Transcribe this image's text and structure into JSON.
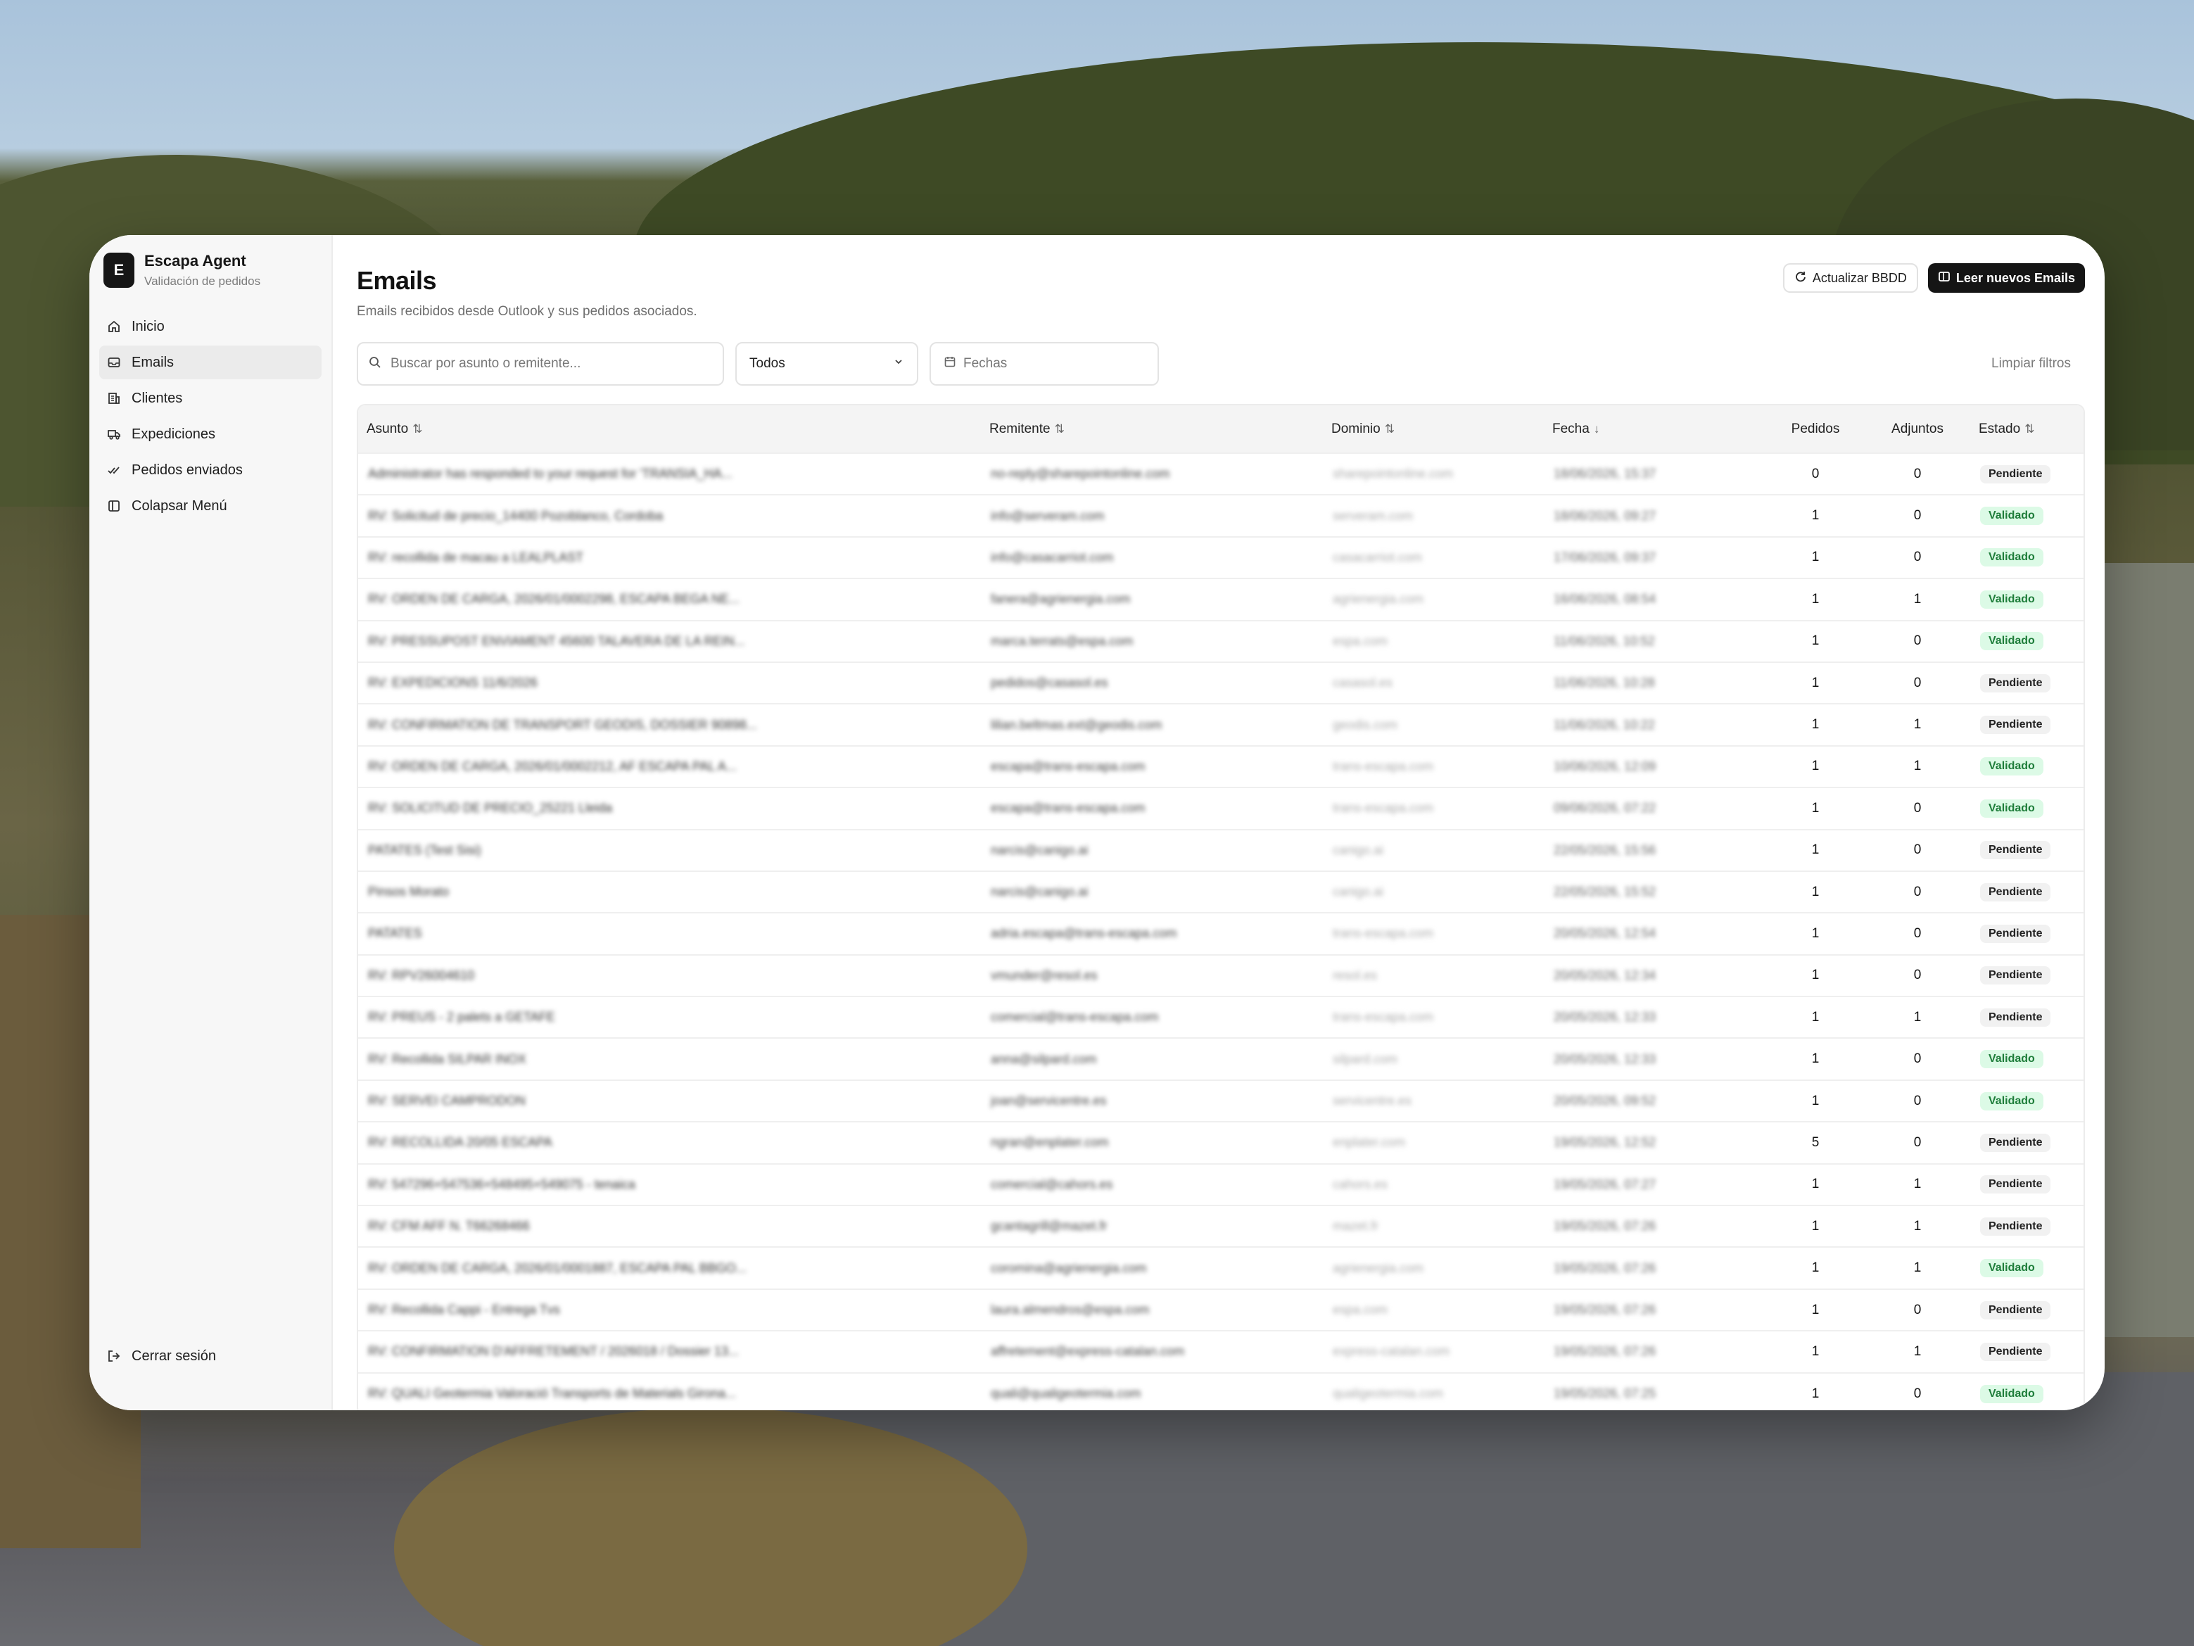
{
  "app": {
    "name": "Escapa Agent",
    "subtitle": "Validación de pedidos",
    "logo_letter": "E"
  },
  "sidebar": {
    "items": [
      {
        "label": "Inicio",
        "icon": "home-icon",
        "active": false
      },
      {
        "label": "Emails",
        "icon": "mail-icon",
        "active": true
      },
      {
        "label": "Clientes",
        "icon": "building-icon",
        "active": false
      },
      {
        "label": "Expediciones",
        "icon": "truck-icon",
        "active": false
      },
      {
        "label": "Pedidos enviados",
        "icon": "check-double-icon",
        "active": false
      },
      {
        "label": "Colapsar Menú",
        "icon": "sidebar-collapse-icon",
        "active": false
      }
    ],
    "logout_label": "Cerrar sesión"
  },
  "header": {
    "title": "Emails",
    "subtitle": "Emails recibidos desde Outlook y sus pedidos asociados.",
    "refresh_label": "Actualizar BBDD",
    "read_label": "Leer nuevos Emails"
  },
  "filters": {
    "search_placeholder": "Buscar por asunto o remitente...",
    "status_selected": "Todos",
    "date_placeholder": "Fechas",
    "clear_label": "Limpiar filtros"
  },
  "table": {
    "columns": {
      "asunto": "Asunto",
      "remitente": "Remitente",
      "dominio": "Dominio",
      "fecha": "Fecha",
      "pedidos": "Pedidos",
      "adjuntos": "Adjuntos",
      "estado": "Estado"
    },
    "rows": [
      {
        "asunto": "Administrator has responded to your request for 'TRANSIA_HA...",
        "remitente": "no-reply@sharepointonline.com",
        "dominio": "sharepointonline.com",
        "fecha": "18/06/2026, 15:37",
        "pedidos": "0",
        "adjuntos": "0",
        "estado": "Pendiente"
      },
      {
        "asunto": "RV: Solicitud de precio_14400 Pozoblanco, Cordoba",
        "remitente": "info@serveram.com",
        "dominio": "serveram.com",
        "fecha": "18/06/2026, 09:27",
        "pedidos": "1",
        "adjuntos": "0",
        "estado": "Validado"
      },
      {
        "asunto": "RV: recollida de macau a LEALPLAST",
        "remitente": "info@casacarriot.com",
        "dominio": "casacarriot.com",
        "fecha": "17/06/2026, 09:37",
        "pedidos": "1",
        "adjuntos": "0",
        "estado": "Validado"
      },
      {
        "asunto": "RV: ORDEN DE CARGA, 2026/01/0002298, ESCAPA BEGA NE...",
        "remitente": "fanera@agrienergia.com",
        "dominio": "agrienergia.com",
        "fecha": "16/06/2026, 08:54",
        "pedidos": "1",
        "adjuntos": "1",
        "estado": "Validado"
      },
      {
        "asunto": "RV: PRESSUPOST ENVIAMENT 45600 TALAVERA DE LA REIN...",
        "remitente": "marca.terrats@espa.com",
        "dominio": "espa.com",
        "fecha": "11/06/2026, 10:52",
        "pedidos": "1",
        "adjuntos": "0",
        "estado": "Validado"
      },
      {
        "asunto": "RV: EXPEDICIONS 11/6/2026",
        "remitente": "pedidos@casasol.es",
        "dominio": "casasol.es",
        "fecha": "11/06/2026, 10:28",
        "pedidos": "1",
        "adjuntos": "0",
        "estado": "Pendiente"
      },
      {
        "asunto": "RV: CONFIRMATION DE TRANSPORT GEODIS, DOSSIER 90898...",
        "remitente": "lilian.beltmas.ext@geodis.com",
        "dominio": "geodis.com",
        "fecha": "11/06/2026, 10:22",
        "pedidos": "1",
        "adjuntos": "1",
        "estado": "Pendiente"
      },
      {
        "asunto": "RV: ORDEN DE CARGA, 2026/01/0002212, AF ESCAPA PAL A...",
        "remitente": "escapa@trans-escapa.com",
        "dominio": "trans-escapa.com",
        "fecha": "10/06/2026, 12:09",
        "pedidos": "1",
        "adjuntos": "1",
        "estado": "Validado"
      },
      {
        "asunto": "RV: SOLICITUD DE PRECIO_25221 Lleida",
        "remitente": "escapa@trans-escapa.com",
        "dominio": "trans-escapa.com",
        "fecha": "09/06/2026, 07:22",
        "pedidos": "1",
        "adjuntos": "0",
        "estado": "Validado"
      },
      {
        "asunto": "PATATES (Test Sisi)",
        "remitente": "narcis@canigo.ai",
        "dominio": "canigo.ai",
        "fecha": "22/05/2026, 15:56",
        "pedidos": "1",
        "adjuntos": "0",
        "estado": "Pendiente"
      },
      {
        "asunto": "Pinsos Morato",
        "remitente": "narcis@canigo.ai",
        "dominio": "canigo.ai",
        "fecha": "22/05/2026, 15:52",
        "pedidos": "1",
        "adjuntos": "0",
        "estado": "Pendiente"
      },
      {
        "asunto": "PATATES",
        "remitente": "adria.escapa@trans-escapa.com",
        "dominio": "trans-escapa.com",
        "fecha": "20/05/2026, 12:54",
        "pedidos": "1",
        "adjuntos": "0",
        "estado": "Pendiente"
      },
      {
        "asunto": "RV: RPV26004610",
        "remitente": "vmunder@resol.es",
        "dominio": "resol.es",
        "fecha": "20/05/2026, 12:34",
        "pedidos": "1",
        "adjuntos": "0",
        "estado": "Pendiente"
      },
      {
        "asunto": "RV: PREUS - 2 palets a GETAFE",
        "remitente": "comercial@trans-escapa.com",
        "dominio": "trans-escapa.com",
        "fecha": "20/05/2026, 12:33",
        "pedidos": "1",
        "adjuntos": "1",
        "estado": "Pendiente"
      },
      {
        "asunto": "RV: Recollida SILPAR INOX",
        "remitente": "anna@silpard.com",
        "dominio": "silpard.com",
        "fecha": "20/05/2026, 12:33",
        "pedidos": "1",
        "adjuntos": "0",
        "estado": "Validado"
      },
      {
        "asunto": "RV: SERVEI CAMPRODON",
        "remitente": "joan@servicentre.es",
        "dominio": "servicentre.es",
        "fecha": "20/05/2026, 09:52",
        "pedidos": "1",
        "adjuntos": "0",
        "estado": "Validado"
      },
      {
        "asunto": "RV: RECOLLIDA 20/05 ESCAPA",
        "remitente": "ngran@enplater.com",
        "dominio": "enplater.com",
        "fecha": "19/05/2026, 12:52",
        "pedidos": "5",
        "adjuntos": "0",
        "estado": "Pendiente"
      },
      {
        "asunto": "RV: 547296+547536+548495+549075 - tenaica",
        "remitente": "comercial@cahors.es",
        "dominio": "cahors.es",
        "fecha": "19/05/2026, 07:27",
        "pedidos": "1",
        "adjuntos": "1",
        "estado": "Pendiente"
      },
      {
        "asunto": "RV: CFM AFF N. T66268466",
        "remitente": "gcantagrill@mazet.fr",
        "dominio": "mazet.fr",
        "fecha": "19/05/2026, 07:26",
        "pedidos": "1",
        "adjuntos": "1",
        "estado": "Pendiente"
      },
      {
        "asunto": "RV: ORDEN DE CARGA, 2026/01/0001887, ESCAPA PAL BBGO...",
        "remitente": "coromina@agrienergia.com",
        "dominio": "agrienergia.com",
        "fecha": "19/05/2026, 07:26",
        "pedidos": "1",
        "adjuntos": "1",
        "estado": "Validado"
      },
      {
        "asunto": "RV: Recollida Cappi - Entrega Tvs",
        "remitente": "laura.almendros@espa.com",
        "dominio": "espa.com",
        "fecha": "19/05/2026, 07:26",
        "pedidos": "1",
        "adjuntos": "0",
        "estado": "Pendiente"
      },
      {
        "asunto": "RV: CONFIRMATION D'AFFRETEMENT / 2026018 / Dossier 13...",
        "remitente": "affretement@express-catalan.com",
        "dominio": "express-catalan.com",
        "fecha": "19/05/2026, 07:26",
        "pedidos": "1",
        "adjuntos": "1",
        "estado": "Pendiente"
      },
      {
        "asunto": "RV: QUALI Geotermia Valoració Transports de Materials Girona...",
        "remitente": "quali@qualigeotermia.com",
        "dominio": "qualigeotermia.com",
        "fecha": "19/05/2026, 07:25",
        "pedidos": "1",
        "adjuntos": "0",
        "estado": "Validado"
      }
    ]
  },
  "colors": {
    "validado_bg": "#dcfae6",
    "validado_fg": "#1e7d3a",
    "pendiente_bg": "#f1f1f1",
    "primary_dark": "#151515"
  }
}
